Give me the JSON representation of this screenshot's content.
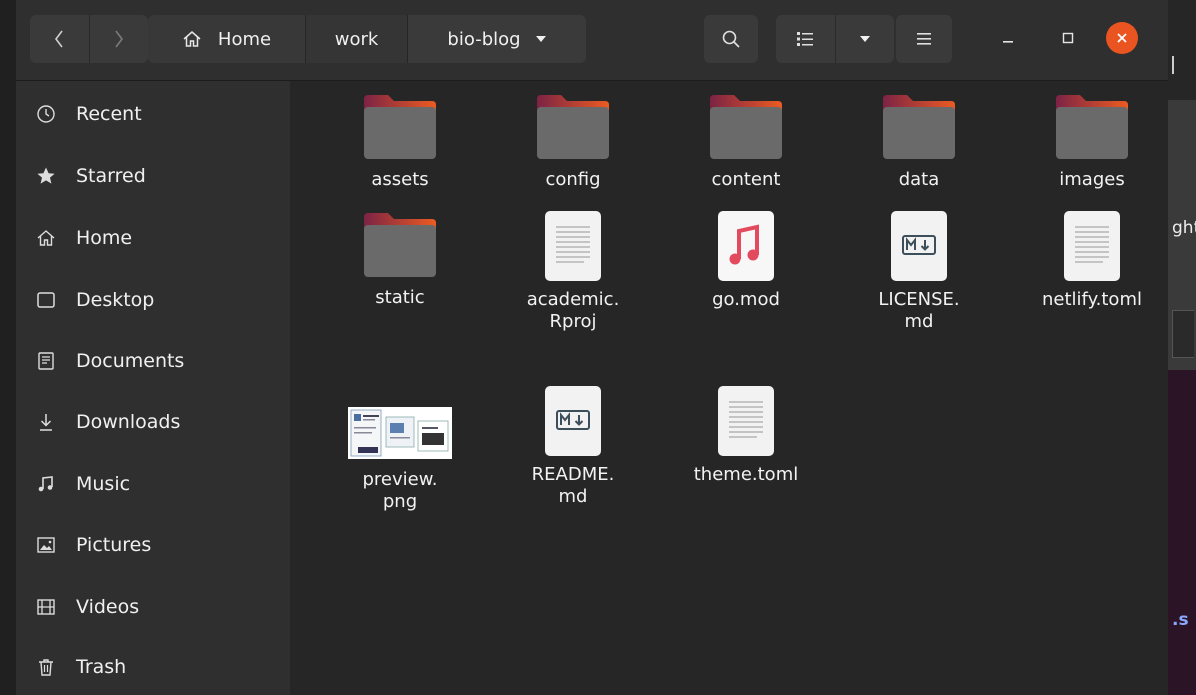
{
  "window": {
    "path": [
      {
        "label": "Home",
        "icon": "home-icon"
      },
      {
        "label": "work"
      },
      {
        "label": "bio-blog",
        "icon": "caret-down-icon"
      }
    ],
    "toolbar_icons": [
      "search-icon",
      "list-view-icon",
      "caret-down-icon",
      "hamburger-menu-icon"
    ],
    "window_controls": [
      "minimize-icon",
      "maximize-icon",
      "close-icon"
    ],
    "accent_color": "#e95420"
  },
  "sidebar": {
    "items": [
      {
        "label": "Recent",
        "icon": "clock-icon"
      },
      {
        "label": "Starred",
        "icon": "star-icon"
      },
      {
        "label": "Home",
        "icon": "home-icon"
      },
      {
        "label": "Desktop",
        "icon": "desktop-icon"
      },
      {
        "label": "Documents",
        "icon": "document-icon"
      },
      {
        "label": "Downloads",
        "icon": "download-icon"
      },
      {
        "label": "Music",
        "icon": "music-note-icon"
      },
      {
        "label": "Pictures",
        "icon": "picture-icon"
      },
      {
        "label": "Videos",
        "icon": "film-icon"
      },
      {
        "label": "Trash",
        "icon": "trash-icon"
      }
    ]
  },
  "files": [
    {
      "name": "assets",
      "type": "folder"
    },
    {
      "name": "config",
      "type": "folder"
    },
    {
      "name": "content",
      "type": "folder"
    },
    {
      "name": "data",
      "type": "folder"
    },
    {
      "name": "images",
      "type": "folder"
    },
    {
      "name": "static",
      "type": "folder"
    },
    {
      "name_line1": "academic.",
      "name_line2": "Rproj",
      "type": "text"
    },
    {
      "name": "go.mod",
      "type": "audio"
    },
    {
      "name_line1": "LICENSE.",
      "name_line2": "md",
      "type": "markdown"
    },
    {
      "name": "netlify.toml",
      "type": "text"
    },
    {
      "name_line1": "preview.",
      "name_line2": "png",
      "type": "image"
    },
    {
      "name_line1": "README.",
      "name_line2": "md",
      "type": "markdown"
    },
    {
      "name": "theme.toml",
      "type": "text"
    }
  ],
  "background": {
    "text_1": "ght",
    "text_2": ".s"
  }
}
